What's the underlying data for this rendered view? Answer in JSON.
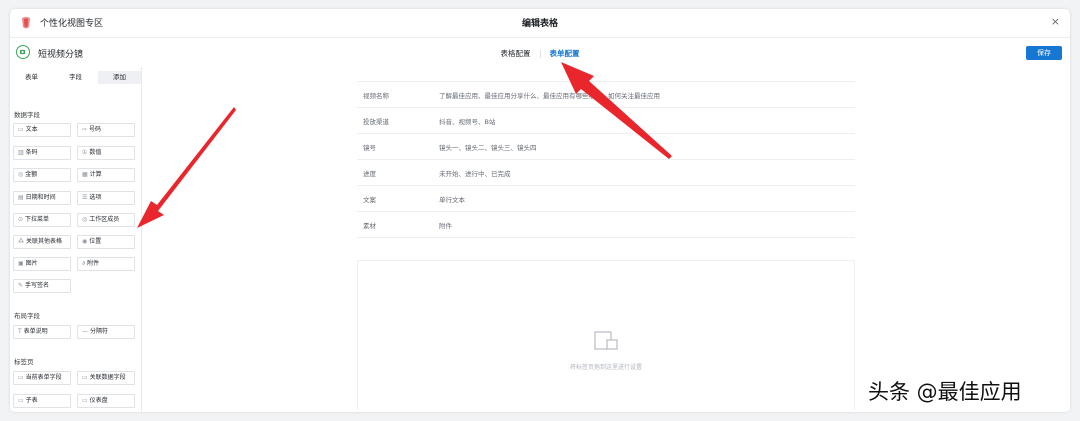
{
  "app": {
    "title": "个性化视图专区"
  },
  "dialog": {
    "title": "编辑表格",
    "close": "×"
  },
  "view": {
    "name": "短视频分镜"
  },
  "tabs": [
    {
      "label": "表格配置",
      "active": false
    },
    {
      "label": "表单配置",
      "active": true
    }
  ],
  "save_label": "保存",
  "sidebar": {
    "tabs": [
      {
        "label": "表单",
        "active": false
      },
      {
        "label": "字段",
        "active": false
      },
      {
        "label": "添加",
        "active": true
      }
    ],
    "groups": {
      "data": {
        "label": "数据字段",
        "items": [
          "文本",
          "号码",
          "条码",
          "数值",
          "金额",
          "计算",
          "日期和时间",
          "选项",
          "下拉菜单",
          "工作区成员",
          "关联其他表格",
          "位置",
          "图片",
          "附件",
          "手写签名"
        ]
      },
      "layout": {
        "label": "布局字段",
        "items": [
          "表单说明",
          "分隔符"
        ]
      },
      "tabpage": {
        "label": "标签页",
        "items": [
          "当前表单字段",
          "关联数据字段",
          "子表",
          "仪表盘"
        ]
      }
    }
  },
  "form": {
    "rows": [
      {
        "label": "视频名称",
        "value": "了解最佳应用、最佳应用分享什么、最佳应用有哪些福利、如何关注最佳应用"
      },
      {
        "label": "投放渠道",
        "value": "抖音、视频号、B站"
      },
      {
        "label": "镜号",
        "value": "镜头一、镜头二、镜头三、镜头四"
      },
      {
        "label": "进度",
        "value": "未开始、进行中、已完成"
      },
      {
        "label": "文案",
        "value": "单行文本"
      },
      {
        "label": "素材",
        "value": "附件"
      }
    ]
  },
  "drop_area": {
    "text": "将标签页拖到这里进行设置"
  },
  "watermark": "头条 @最佳应用",
  "colors": {
    "accent": "#1677d2",
    "arrow": "#e8262b",
    "view_icon": "#3aa55b"
  }
}
